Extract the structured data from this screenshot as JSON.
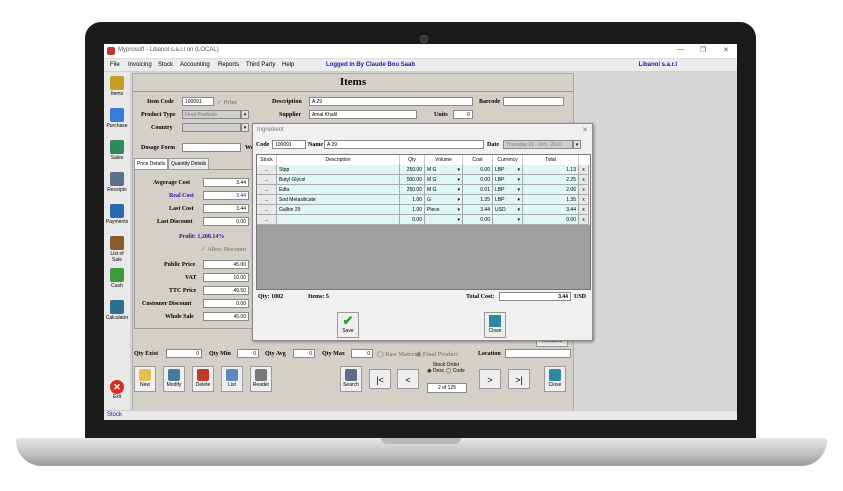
{
  "window": {
    "title": "Myprosoft - Libanol s.a.r.l on (LOCAL)",
    "controls": [
      "—",
      "❐",
      "✕"
    ]
  },
  "menu": {
    "items": [
      "File",
      "Invoicing",
      "Stock",
      "Accounting",
      "Reports",
      "Third Party",
      "Help"
    ],
    "logged_in": "Logged In By Claude Bou Saab",
    "company": "Libanol s.a.r.l"
  },
  "toolbar": {
    "items": [
      {
        "label": "Items",
        "icon": "items-icon",
        "color": "#c8a020"
      },
      {
        "label": "Purchase",
        "icon": "purchase-icon",
        "color": "#3a7bd5"
      },
      {
        "label": "Sales",
        "icon": "sales-icon",
        "color": "#2e8b57"
      },
      {
        "label": "Receipts",
        "icon": "receipts-icon",
        "color": "#5a6f8a"
      },
      {
        "label": "Payments",
        "icon": "payments-icon",
        "color": "#2a6ab0"
      },
      {
        "label": "List of Sale",
        "icon": "list-of-sale-icon",
        "color": "#8a5a2a"
      },
      {
        "label": "Cash",
        "icon": "cash-icon",
        "color": "#3c9a3c"
      },
      {
        "label": "Calculator",
        "icon": "calculator-icon",
        "color": "#2f6f8f"
      }
    ],
    "exit_label": "Exit"
  },
  "form": {
    "title": "Items",
    "item_code_label": "Item Code",
    "item_code": "100091",
    "print_label": "Print",
    "description_label": "Description",
    "description": "A 29",
    "barcode_label": "Barcode",
    "barcode": "",
    "product_type_label": "Product Type",
    "product_type": "Final Products",
    "supplier_label": "Supplier",
    "supplier": "Amal Khalil",
    "units_label": "Units",
    "units": "0",
    "country_label": "Country",
    "country": "",
    "dosage_form_label": "Dosage Form",
    "dosage_form": "",
    "we_label": "We",
    "tabs": [
      "Price Details",
      "Quantity Details"
    ],
    "average_cost_label": "Avgerage Cost",
    "average_cost": "3.44",
    "real_cost_label": "Real Cost",
    "real_cost": "3.44",
    "last_cost_label": "Last Cost",
    "last_cost": "3.44",
    "last_discount_label": "Last Discount",
    "last_discount": "0.00",
    "profit": "Profit: 1,208.14%",
    "allow_discount_label": "Allow Discount",
    "public_price_label": "Public Price",
    "public_price": "45.00",
    "vat_label": "VAT",
    "vat": "10.00",
    "ttc_price_label": "TTC Price",
    "ttc_price": "49.50",
    "customer_discount_label": "Customer Discount",
    "customer_discount": "0.00",
    "whole_sale_label": "Whole Sale",
    "whole_sale": "45.00",
    "remarks_label": "Remarks",
    "qty_exist_label": "Qty Exist",
    "qty_exist": "0",
    "qty_min_label": "Qty Min",
    "qty_min": "0",
    "qty_avg_label": "Qty Avg",
    "qty_avg": "0",
    "qty_max_label": "Qty Max",
    "qty_max": "0",
    "raw_material_label": "Raw Material",
    "final_product_label": "Final Product",
    "location_label": "Location",
    "location": ""
  },
  "actions": {
    "new_label": "New",
    "modify_label": "Modify",
    "delete_label": "Delete",
    "list_label": "List",
    "reader_label": "Reader",
    "search_label": "Search",
    "first": "|<",
    "prev": "<",
    "next": ">",
    "last": ">|",
    "stock_order_label": "Stock Order",
    "desc_label": "Desc",
    "code_label": "Code",
    "pager": "2 of 125",
    "close_label": "Close"
  },
  "dialog": {
    "title": "Ingredient",
    "code_label": "Code",
    "code": "100091",
    "name_label": "Name",
    "name": "A 29",
    "date_label": "Date",
    "date": "Thursday   21 - Oct - 2010",
    "columns": [
      "Stock",
      "Description",
      "Qty",
      "Volume",
      "Cost",
      "Currency",
      "Total"
    ],
    "rows": [
      {
        "stock": "...",
        "description": "Stpp",
        "qty": "250.00",
        "volume": "M G",
        "cost": "0.00",
        "currency": "LBP",
        "total": "1.13"
      },
      {
        "stock": "...",
        "description": "Butyl Glycol",
        "qty": "500.00",
        "volume": "M G",
        "cost": "0.00",
        "currency": "LBP",
        "total": "2.25"
      },
      {
        "stock": "...",
        "description": "Edta",
        "qty": "250.00",
        "volume": "M G",
        "cost": "0.01",
        "currency": "LBP",
        "total": "2.06"
      },
      {
        "stock": "...",
        "description": "Sod Metasilicate",
        "qty": "1.00",
        "volume": "G",
        "cost": "1.35",
        "currency": "LBP",
        "total": "1.35"
      },
      {
        "stock": "...",
        "description": "Gallon 29",
        "qty": "1.00",
        "volume": "Piece",
        "cost": "3.44",
        "currency": "USD",
        "total": "3.44"
      },
      {
        "stock": "...",
        "description": "",
        "qty": "0.00",
        "volume": "",
        "cost": "0.00",
        "currency": "",
        "total": "0.00"
      }
    ],
    "qty_label": "Qty: 1002",
    "items_label": "Items: 5",
    "total_cost_label": "Total Cost:",
    "total_cost": "3.44",
    "total_currency": "USD",
    "save_label": "Save",
    "close_label": "Close"
  },
  "status": {
    "text": "Stock"
  },
  "colors": {
    "accent_blue": "#1a1aa8",
    "row_bg": "#dff6f6",
    "save_green": "#2e9e2e"
  }
}
